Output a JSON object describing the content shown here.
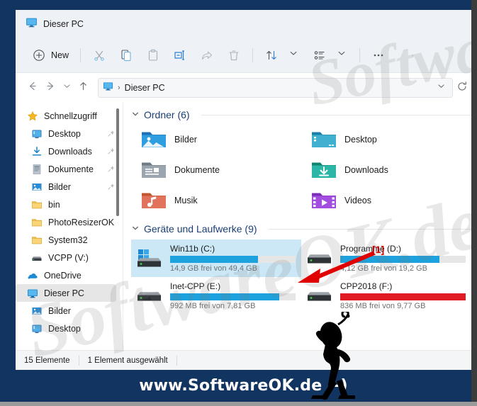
{
  "window": {
    "title": "Dieser PC",
    "title_icon": "this-pc-monitor-icon"
  },
  "toolbar": {
    "new_label": "New",
    "items": [
      {
        "name": "new-button",
        "label": "New",
        "icon": "plus-circle-icon"
      },
      {
        "name": "cut-button",
        "label": "",
        "icon": "scissors-icon"
      },
      {
        "name": "copy-button",
        "label": "",
        "icon": "copy-icon"
      },
      {
        "name": "paste-button",
        "label": "",
        "icon": "clipboard-paste-icon"
      },
      {
        "name": "rename-button",
        "label": "",
        "icon": "rename-icon"
      },
      {
        "name": "share-button",
        "label": "",
        "icon": "share-icon"
      },
      {
        "name": "delete-button",
        "label": "",
        "icon": "trash-icon"
      },
      {
        "name": "sort-button",
        "label": "",
        "icon": "sort-arrows-icon"
      },
      {
        "name": "view-button",
        "label": "",
        "icon": "view-list-icon"
      },
      {
        "name": "more-button",
        "label": "",
        "icon": "ellipsis-icon"
      }
    ]
  },
  "address": {
    "back_icon": "arrow-left-icon",
    "forward_icon": "arrow-right-icon",
    "recent_icon": "chevron-down-icon",
    "up_icon": "arrow-up-icon",
    "path_icon": "this-pc-monitor-icon",
    "separator": "›",
    "crumb": "Dieser PC",
    "dropdown_icon": "chevron-down-icon",
    "refresh_icon": "refresh-icon"
  },
  "sidebar": {
    "items": [
      {
        "label": "Schnellzugriff",
        "icon": "star-icon",
        "pinned": false,
        "indent": false,
        "selected": false
      },
      {
        "label": "Desktop",
        "icon": "desktop-icon",
        "pinned": true,
        "indent": true,
        "selected": false
      },
      {
        "label": "Downloads",
        "icon": "downloads-icon",
        "pinned": true,
        "indent": true,
        "selected": false
      },
      {
        "label": "Dokumente",
        "icon": "documents-icon",
        "pinned": true,
        "indent": true,
        "selected": false
      },
      {
        "label": "Bilder",
        "icon": "pictures-icon",
        "pinned": true,
        "indent": true,
        "selected": false
      },
      {
        "label": "bin",
        "icon": "folder-icon",
        "pinned": false,
        "indent": true,
        "selected": false
      },
      {
        "label": "PhotoResizerOK",
        "icon": "folder-icon",
        "pinned": false,
        "indent": true,
        "selected": false
      },
      {
        "label": "System32",
        "icon": "folder-icon",
        "pinned": false,
        "indent": true,
        "selected": false
      },
      {
        "label": "VCPP (V:)",
        "icon": "drive-icon",
        "pinned": false,
        "indent": true,
        "selected": false
      },
      {
        "label": "OneDrive",
        "icon": "onedrive-cloud-icon",
        "pinned": false,
        "indent": false,
        "selected": false
      },
      {
        "label": "Dieser PC",
        "icon": "this-pc-monitor-icon",
        "pinned": false,
        "indent": false,
        "selected": true
      },
      {
        "label": "Bilder",
        "icon": "pictures-icon",
        "pinned": false,
        "indent": true,
        "selected": false
      },
      {
        "label": "Desktop",
        "icon": "desktop-icon",
        "pinned": false,
        "indent": true,
        "selected": false
      }
    ]
  },
  "content": {
    "folders_group": {
      "title": "Ordner (6)",
      "chevron": "⌄",
      "items": [
        {
          "label": "Bilder",
          "icon": "pictures-folder-icon"
        },
        {
          "label": "Desktop",
          "icon": "desktop-folder-icon"
        },
        {
          "label": "Dokumente",
          "icon": "documents-folder-icon"
        },
        {
          "label": "Downloads",
          "icon": "downloads-folder-icon"
        },
        {
          "label": "Musik",
          "icon": "music-folder-icon"
        },
        {
          "label": "Videos",
          "icon": "videos-folder-icon"
        }
      ]
    },
    "drives_group": {
      "title": "Geräte und Laufwerke (9)",
      "chevron": "⌄",
      "items": [
        {
          "name": "Win11b (C:)",
          "free_text": "14,9 GB frei von 49,4 GB",
          "used_percent": 70,
          "bar_color": "#1ea2dd",
          "selected": true,
          "icon": "windows-drive-icon"
        },
        {
          "name": "Programme (D:)",
          "free_text": "4,12 GB frei von 19,2 GB",
          "used_percent": 79,
          "bar_color": "#1ea2dd",
          "selected": false,
          "icon": "drive-icon"
        },
        {
          "name": "Inet-CPP (E:)",
          "free_text": "992 MB frei von 7,81 GB",
          "used_percent": 87,
          "bar_color": "#1ea2dd",
          "selected": false,
          "icon": "drive-icon"
        },
        {
          "name": "CPP2018 (F:)",
          "free_text": "836 MB frei von 9,77 GB",
          "used_percent": 100,
          "bar_color": "#e01b24",
          "selected": false,
          "icon": "drive-icon"
        }
      ]
    }
  },
  "statusbar": {
    "count_text": "15 Elemente",
    "selection_text": "1 Element ausgewählt"
  },
  "annotation": {
    "number_label": "[1]",
    "arrow_color": "#e00000"
  },
  "banner": {
    "text": "www.SoftwareOK.de :-)",
    "background": "#123461"
  },
  "watermark": {
    "text": "SoftwareOK.de"
  }
}
